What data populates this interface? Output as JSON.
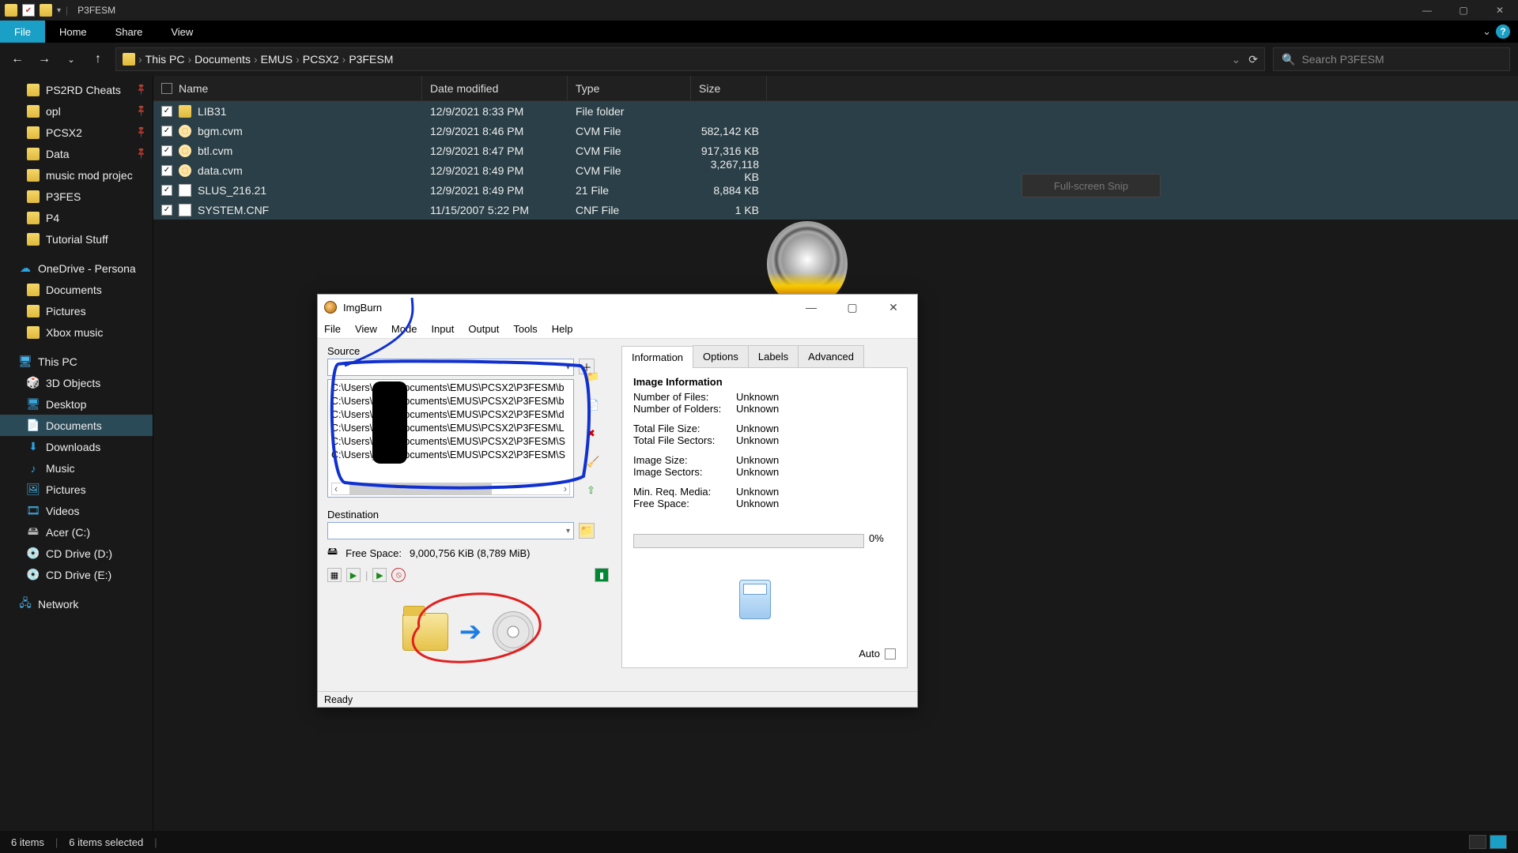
{
  "window": {
    "title": "P3FESM"
  },
  "ribbon": {
    "file": "File",
    "tabs": [
      "Home",
      "Share",
      "View"
    ]
  },
  "breadcrumb": [
    "This PC",
    "Documents",
    "EMUS",
    "PCSX2",
    "P3FESM"
  ],
  "search_placeholder": "Search P3FESM",
  "columns": {
    "name": "Name",
    "date": "Date modified",
    "type": "Type",
    "size": "Size"
  },
  "sidebar": {
    "quick": [
      {
        "label": "PS2RD Cheats",
        "pinned": true
      },
      {
        "label": "opl",
        "pinned": true
      },
      {
        "label": "PCSX2",
        "pinned": true
      },
      {
        "label": "Data",
        "pinned": true
      },
      {
        "label": "music mod projec"
      },
      {
        "label": "P3FES"
      },
      {
        "label": "P4"
      },
      {
        "label": "Tutorial Stuff"
      }
    ],
    "onedrive": {
      "label": "OneDrive - Persona",
      "children": [
        "Documents",
        "Pictures",
        "Xbox music"
      ]
    },
    "thispc": {
      "label": "This PC",
      "children": [
        "3D Objects",
        "Desktop",
        "Documents",
        "Downloads",
        "Music",
        "Pictures",
        "Videos",
        "Acer (C:)",
        "CD Drive (D:)",
        "CD Drive (E:)"
      ]
    },
    "network": "Network"
  },
  "files": [
    {
      "name": "LIB31",
      "date": "12/9/2021 8:33 PM",
      "type": "File folder",
      "size": "",
      "icon": "folder",
      "selected": true
    },
    {
      "name": "bgm.cvm",
      "date": "12/9/2021 8:46 PM",
      "type": "CVM File",
      "size": "582,142 KB",
      "icon": "cvm",
      "selected": true
    },
    {
      "name": "btl.cvm",
      "date": "12/9/2021 8:47 PM",
      "type": "CVM File",
      "size": "917,316 KB",
      "icon": "cvm",
      "selected": true
    },
    {
      "name": "data.cvm",
      "date": "12/9/2021 8:49 PM",
      "type": "CVM File",
      "size": "3,267,118 KB",
      "icon": "cvm",
      "selected": true
    },
    {
      "name": "SLUS_216.21",
      "date": "12/9/2021 8:49 PM",
      "type": "21 File",
      "size": "8,884 KB",
      "icon": "file",
      "selected": true
    },
    {
      "name": "SYSTEM.CNF",
      "date": "11/15/2007 5:22 PM",
      "type": "CNF File",
      "size": "1 KB",
      "icon": "file",
      "selected": true
    }
  ],
  "status": {
    "items": "6 items",
    "selected": "6 items selected"
  },
  "snip_toast": "Full-screen Snip",
  "imgburn": {
    "title": "ImgBurn",
    "menu": [
      "File",
      "View",
      "Mode",
      "Input",
      "Output",
      "Tools",
      "Help"
    ],
    "source_label": "Source",
    "source_paths": [
      "C:\\Users\\____\\Documents\\EMUS\\PCSX2\\P3FESM\\b",
      "C:\\Users\\____\\Documents\\EMUS\\PCSX2\\P3FESM\\b",
      "C:\\Users\\____\\Documents\\EMUS\\PCSX2\\P3FESM\\d",
      "C:\\Users\\____\\Documents\\EMUS\\PCSX2\\P3FESM\\L",
      "C:\\Users\\____\\Documents\\EMUS\\PCSX2\\P3FESM\\S",
      "C:\\Users\\____\\Documents\\EMUS\\PCSX2\\P3FESM\\S"
    ],
    "destination_label": "Destination",
    "free_space_label": "Free Space:",
    "free_space_value": "9,000,756 KiB  (8,789 MiB)",
    "tabs": {
      "info": "Information",
      "options": "Options",
      "labels": "Labels",
      "advanced": "Advanced"
    },
    "info": {
      "header": "Image Information",
      "rows": [
        {
          "k": "Number of Files:",
          "v": "Unknown"
        },
        {
          "k": "Number of Folders:",
          "v": "Unknown"
        },
        {
          "k": "Total File Size:",
          "v": "Unknown"
        },
        {
          "k": "Total File Sectors:",
          "v": "Unknown"
        },
        {
          "k": "Image Size:",
          "v": "Unknown"
        },
        {
          "k": "Image Sectors:",
          "v": "Unknown"
        },
        {
          "k": "Min. Req. Media:",
          "v": "Unknown"
        },
        {
          "k": "Free Space:",
          "v": "Unknown"
        }
      ],
      "progress_pct": "0%",
      "auto_label": "Auto"
    },
    "status": "Ready"
  }
}
